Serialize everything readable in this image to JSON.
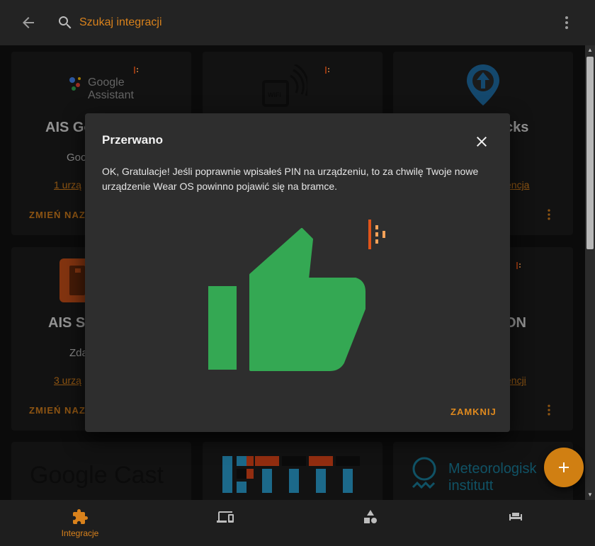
{
  "search": {
    "placeholder": "Szukaj integracji"
  },
  "cards": [
    {
      "title": "AIS Go",
      "subtitle": "Goo",
      "link": "1 urzą",
      "action": "ZMIEŃ NAZW"
    },
    {
      "title": "",
      "subtitle": "",
      "link": "",
      "action": ""
    },
    {
      "title": "cks",
      "subtitle": "s",
      "link": "encja",
      "action": ""
    },
    {
      "title": "AIS Se",
      "subtitle": "Zda",
      "link": "3 urzą",
      "action": "ZMIEŃ NAZW"
    },
    {
      "title": "",
      "subtitle": "",
      "link": "",
      "action": ""
    },
    {
      "title": "ON",
      "subtitle": "",
      "link": "encji",
      "action": ""
    }
  ],
  "logos": {
    "google_assistant": [
      "Google",
      "Assistant"
    ],
    "wifi_badge": "WiFi",
    "google_cast": "Google Cast",
    "meteorologisk": [
      "Meteorologisk",
      "institutt"
    ]
  },
  "dialog": {
    "title": "Przerwano",
    "message": "OK, Gratulacje! Jeśli poprawnie wpisałeś PIN na urządzeniu, to za chwilę Twoje nowe urządzenie Wear OS powinno pojawić się na bramce.",
    "close_button": "ZAMKNIJ"
  },
  "bottom_nav": [
    {
      "label": "Integracje",
      "icon": "puzzle-icon"
    },
    {
      "label": "",
      "icon": "devices-icon"
    },
    {
      "label": "",
      "icon": "shapes-icon"
    },
    {
      "label": "",
      "icon": "sofa-icon"
    }
  ],
  "colors": {
    "accent": "#d9821c",
    "surface": "#1c1c1c",
    "dialog": "#2e2e2e",
    "thumb": "#34a853"
  }
}
